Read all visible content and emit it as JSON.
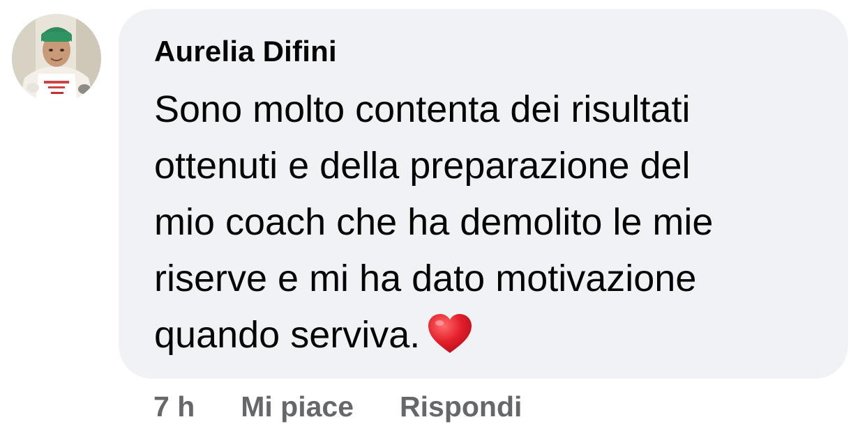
{
  "comment": {
    "author": "Aurelia Difini",
    "lines": [
      "Sono molto contenta dei risultati",
      "ottenuti e della preparazione del",
      "mio coach che ha demolito le mie",
      "riserve e mi ha dato motivazione",
      "quando serviva."
    ],
    "emoji": "heart-emoji",
    "bubble_color": "#f0f2f5",
    "text_color": "#050505"
  },
  "actions": {
    "time": "7 h",
    "like_label": "Mi piace",
    "reply_label": "Rispondi",
    "color": "#65676b"
  },
  "avatar": {
    "icon": "profile-photo"
  }
}
